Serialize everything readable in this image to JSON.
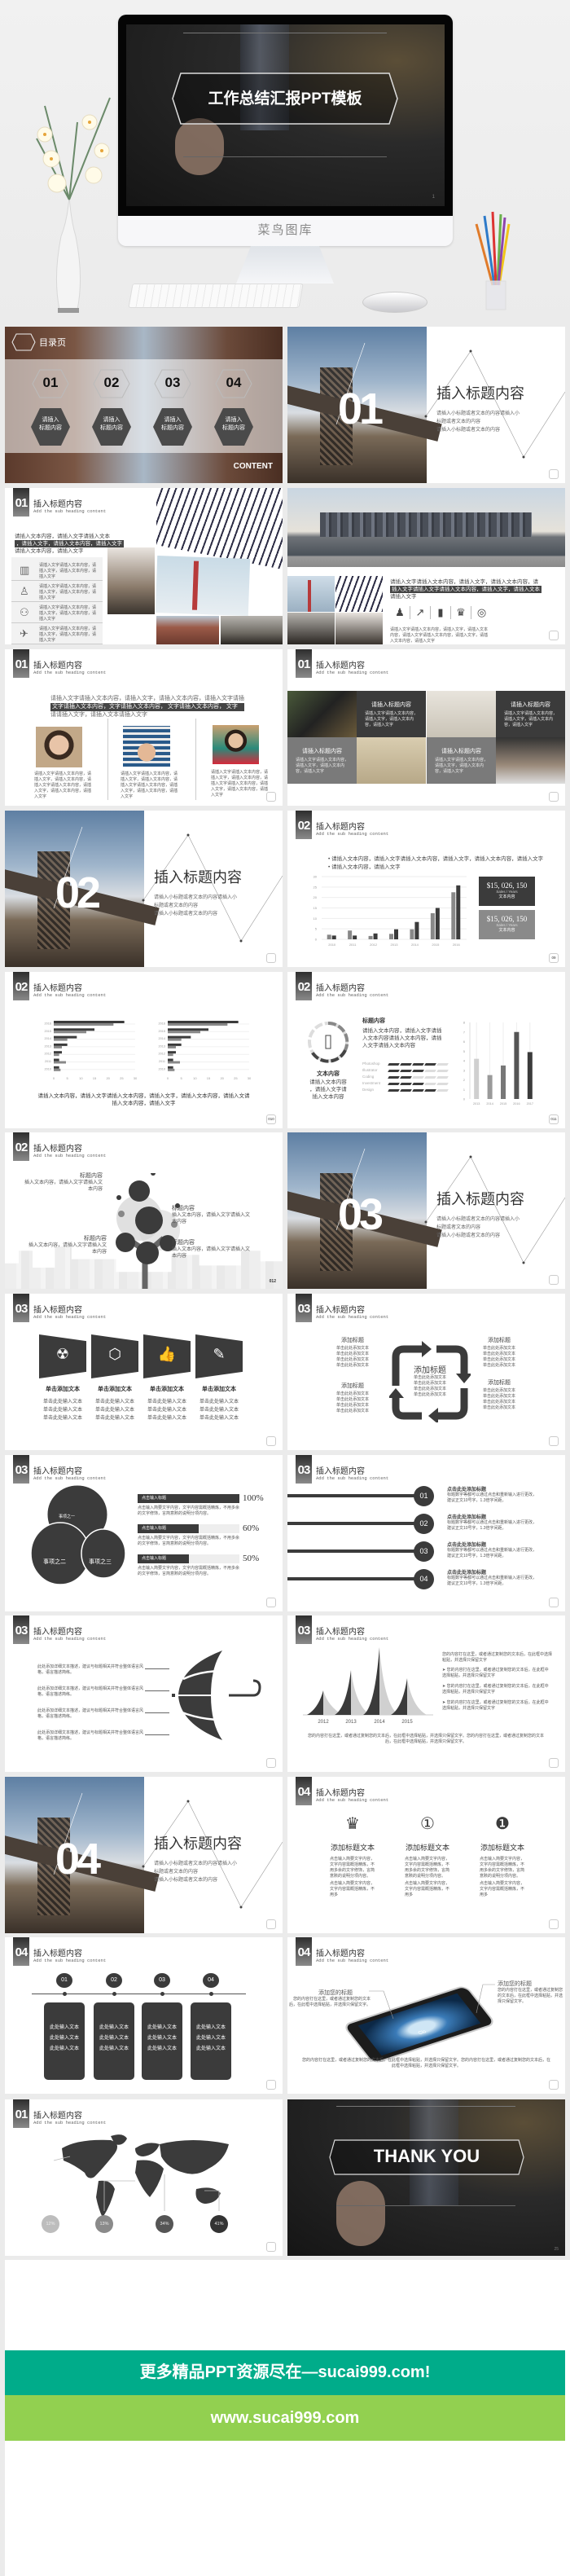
{
  "colors": {
    "dark": "#3b3b3b",
    "gray": "#8a8a8a",
    "banner_teal": "#00ac8a",
    "banner_green": "#92d050",
    "page_bg": "#ebebeb"
  },
  "hero": {
    "slide_title": "工作总结汇报PPT模板",
    "brand": "菜鸟图库",
    "slide_number": "1"
  },
  "common": {
    "heading": "插入标题内容",
    "subheading": "Add the sub heading content"
  },
  "section": {
    "title": "插入标题内容",
    "desc": [
      "请插入小标题或者文本的内容请插入小",
      "标题或者文本的内容",
      "请插入小标题或者文本的内容"
    ],
    "numbers": [
      "01",
      "02",
      "03",
      "04"
    ]
  },
  "toc": {
    "title": "目录页",
    "items": [
      {
        "num": "01",
        "label": "请插入\n标题内容"
      },
      {
        "num": "02",
        "label": "请插入\n标题内容"
      },
      {
        "num": "03",
        "label": "请插入\n标题内容"
      },
      {
        "num": "04",
        "label": "请插入\n标题内容"
      }
    ],
    "content_label": "CONTENT"
  },
  "collage": {
    "num": "01",
    "lines": [
      "请插入文本内容，请插入文字请插入文本",
      "，请插入文字，请插入文本内容，请插入文字",
      "请插入文本内容，请插入文字"
    ],
    "list": [
      {
        "icon": "building-icon",
        "text": "请插入文字请插入文本内容，请插入文字，请插入文本内容，请插入文字"
      },
      {
        "icon": "office-chair-icon",
        "text": "请插入文字请插入文本内容，请插入文字，请插入文本内容，请插入文字"
      },
      {
        "icon": "meeting-icon",
        "text": "请插入文字请插入文本内容，请插入文字，请插入文本内容，请插入文字"
      },
      {
        "icon": "airplane-icon",
        "text": "请插入文字请插入文本内容，请插入文字，请插入文本内容，请插入文字"
      }
    ]
  },
  "skyline": {
    "lines": [
      "请插入文字请插入文本内容，请插入文字，请插入文本内容，请",
      "插入文字请插入文字请插入文本内容，请插入文字，请插入文本",
      "请插入文字"
    ],
    "icons": [
      "team-icon",
      "growth-chart-icon",
      "bar-chart-icon",
      "trophy-icon",
      "coins-icon"
    ],
    "small": "请插入文字请插入文本内容，请插入文字，请插入文本内容，请插入文字请插入文本内容，请插入文字，请插入文本内容，请插入文字"
  },
  "kids": {
    "num": "01",
    "lines": [
      "请插入文字请插入文本内容，请插入文字，请插入文本内容，请插入文字请插",
      "文字请插入文本内容，文字请插入文本内容，   文字请插入文本内容，   文字",
      "请请插入文字，请插入文本请插入文字"
    ],
    "captions": [
      "请插入文字请插入文本内容，请插入文字，请插入文本内容，请插入文字请插入文本内容，请插入文字，请插入文本内容，请插入文字",
      "请插入文字请插入文本内容，请插入文字，请插入文本内容，请插入文字请插入文本内容，请插入文字，请插入文本内容，请插入文字",
      "请插入文字请插入文本内容，请插入文字，请插入文本内容，请插入文字请插入文本内容，请插入文字，请插入文本内容，请插入文字"
    ]
  },
  "tiles": {
    "num": "01",
    "items": [
      {
        "title": "请插入标题内容",
        "text": "请插入文字请插入文本内容，请插入文字，请插入文本内容，请插入文字"
      },
      {
        "title": "请插入标题内容",
        "text": "请插入文字请插入文本内容，请插入文字，请插入文本内容，请插入文字"
      },
      {
        "title": "请插入标题内容",
        "text": "请插入文字请插入文本内容，请插入文字，请插入文本内容，请插入文字"
      },
      {
        "title": "请插入标题内容",
        "text": "请插入文字请插入文本内容，请插入文字，请插入文本内容，请插入文字"
      }
    ]
  },
  "barslide": {
    "num": "02",
    "bullets": [
      "请插入文本内容，请插入文字请插入文本内容，请插入文字，请插入文本内容，请插入文字",
      "请插入文本内容，请插入文字"
    ],
    "boxes": [
      {
        "value": "$15, 026, 150",
        "sub": "Sales / Years",
        "label": "文本内容"
      },
      {
        "value": "$15, 026, 150",
        "sub": "Sales / Years",
        "label": "文本内容"
      }
    ],
    "page": "09"
  },
  "hbarslide": {
    "num": "02",
    "caption": [
      "请插入文本内容，请插入文字请插入文本内容，请插入文字，请插入文本内容，请插入文请",
      "插入文本内容，请插入文字"
    ],
    "page": "010"
  },
  "donutslide": {
    "num": "02",
    "title": "标题内容",
    "text": [
      "请插入文本内容，请插入文字请插",
      "入文本内容请插入文本内容，请插",
      "入文字请插入文本内容"
    ],
    "left_title": "文本内容",
    "left_text": [
      "请插入文本内容",
      "，请插入文字请",
      "插入文本内容"
    ],
    "skills": [
      {
        "name": "Photoshop",
        "level": 4,
        "max": 5
      },
      {
        "name": "Illustrator",
        "level": 3,
        "max": 5
      },
      {
        "name": "Coding",
        "level": 2,
        "max": 5
      },
      {
        "name": "Investment",
        "level": 3,
        "max": 5
      },
      {
        "name": "Design",
        "level": 4,
        "max": 5
      }
    ],
    "page": "011"
  },
  "tree": {
    "num": "02",
    "items": [
      {
        "title": "标题内容",
        "text": "插入文本内容，请插入文字请插入文本内容"
      },
      {
        "title": "标题内容",
        "text": "插入文本内容，请插入文字请插入文本内容"
      },
      {
        "title": "标题内容",
        "text": "插入文本内容，请插入文字请插入文本内容"
      },
      {
        "title": "标题内容",
        "text": "插入文本内容，请插入文字请插入文本内容"
      }
    ],
    "page": "012"
  },
  "trap": {
    "num": "03",
    "items": [
      {
        "icon": "radiation-icon",
        "title": "单击添加文本"
      },
      {
        "icon": "cube-icon",
        "title": "单击添加文本"
      },
      {
        "icon": "thumbs-up-icon",
        "title": "单击添加文本"
      },
      {
        "icon": "pencil-icon",
        "title": "单击添加文本"
      }
    ],
    "line": "单击此处输入文本"
  },
  "cycle": {
    "num": "03",
    "center": "添加标题",
    "title": "添加标题",
    "line": "单击此处添加文本"
  },
  "venn": {
    "num": "03",
    "circles": [
      "事项之一",
      "事项之二",
      "事项之三"
    ],
    "bars": [
      {
        "label": "点击输入标题",
        "percent": 100
      },
      {
        "label": "点击输入标题",
        "percent": 60
      },
      {
        "label": "点击输入标题",
        "percent": 50
      }
    ],
    "desc": "点击输入简要文字内容，文字内容需概括精炼，不用多余的文字修饰，言简意赅的说明分项内容。"
  },
  "lines": {
    "num": "03",
    "items": [
      {
        "n": "01",
        "title": "点击此处添加标题"
      },
      {
        "n": "02",
        "title": "点击此处添加标题"
      },
      {
        "n": "03",
        "title": "点击此处添加标题"
      },
      {
        "n": "04",
        "title": "点击此处添加标题"
      }
    ],
    "desc": "标题数字等都可以通过点击和重新输入进行更改，建议正文10号字，1.3倍字间距。"
  },
  "umbrella": {
    "num": "03",
    "text": "此处添加详细文本描述，建议与标题相关并符合整体语言风格，语言描述简练。"
  },
  "mountain": {
    "num": "03",
    "intro": "您的内容打在这里，或者通过复制您的文本后，在此框中选择粘贴，并选择只保留文字",
    "bullets": [
      "您的内容打在这里，或者通过复制您的文本后，在此框中选择粘贴，并选择只保留文字",
      "您的内容打在这里，或者通过复制您的文本后，在此框中选择粘贴，并选择只保留文字",
      "您的内容打在这里，或者通过复制您的文本后，在此框中选择粘贴，并选择只保留文字"
    ],
    "bottom": "您的内容打在这里，或者通过复制您的文本后，在此框中选择粘贴，并选择只保留文字。您的内容打在这里，或者通过复制您的文本后，在此框中选择粘贴，并选择只保留文字。"
  },
  "awards": {
    "num": "04",
    "items": [
      {
        "icon": "trophy-icon",
        "title": "添加标题文本"
      },
      {
        "icon": "medal-icon",
        "title": "添加标题文本"
      },
      {
        "icon": "badge-icon",
        "title": "添加标题文本"
      }
    ],
    "text": "点击输入简要文字内容，文字内容需概括精炼，不用多余的文字修饰，言简意赅的说明分项内容。"
  },
  "timeline": {
    "num": "04",
    "items": [
      "01",
      "02",
      "03",
      "04"
    ],
    "line": "此处输入文本"
  },
  "phone": {
    "num": "04",
    "labels": [
      "添加您的标题",
      "添加您的标题"
    ],
    "text": "您的内容打在这里，或者通过复制您的文本后，在此框中选择粘贴，并选择只保留文字。",
    "screen_text": "Clo",
    "bottom": "您的内容打在这里，或者通过复制您的文本后，在此框中选择粘贴，并选择只保留文字。您的内容打在这里，或者通过复制您的文本后，在此框中选择粘贴，并选择只保留文字。"
  },
  "map": {
    "num": "01",
    "markers": [
      {
        "value": "12%",
        "color": "#bdbdbd"
      },
      {
        "value": "13%",
        "color": "#8a8a8a"
      },
      {
        "value": "34%",
        "color": "#555555"
      },
      {
        "value": "41%",
        "color": "#333333"
      }
    ]
  },
  "thanks": {
    "title": "THANK YOU",
    "page": "25"
  },
  "banner": {
    "line1": "更多精品PPT资源尽在—sucai999.com!",
    "line2": "www.sucai999.com"
  },
  "chart_data": [
    {
      "type": "bar",
      "categories": [
        "2010",
        "2011",
        "2012",
        "2013",
        "2014",
        "2015",
        "2016"
      ],
      "series": [
        {
          "values": [
            2.2,
            4.2,
            1.6,
            2.6,
            4.8,
            12.5,
            22.5
          ]
        },
        {
          "values": [
            1.8,
            1.8,
            2.8,
            4.8,
            8.3,
            15,
            25.8
          ]
        }
      ],
      "ylim": [
        0,
        30
      ],
      "yticks": [
        "0",
        "5",
        "10",
        "15",
        "20",
        "25",
        "30"
      ],
      "grid": true
    },
    {
      "type": "bar",
      "orientation": "horizontal",
      "categories": [
        "2016",
        "2015",
        "2014",
        "2013",
        "2012",
        "2011",
        "2010"
      ],
      "series": [
        {
          "values": [
            26,
            15,
            8.5,
            5,
            3,
            2,
            2
          ]
        },
        {
          "values": [
            22,
            12,
            5,
            3,
            2,
            4.5,
            2.5
          ]
        }
      ],
      "xlim": [
        0,
        30
      ],
      "xticks": [
        "0",
        "5",
        "10",
        "15",
        "20",
        "25",
        "30"
      ]
    },
    {
      "type": "bar",
      "orientation": "horizontal",
      "categories": [
        "2016",
        "2015",
        "2014",
        "2013",
        "2012",
        "2011",
        "2010"
      ],
      "series": [
        {
          "values": [
            26,
            15,
            8.5,
            5,
            3,
            2,
            2
          ]
        },
        {
          "values": [
            22,
            12,
            5,
            3,
            2,
            4.5,
            2.5
          ]
        }
      ],
      "xlim": [
        0,
        30
      ],
      "xticks": [
        "0",
        "5",
        "10",
        "15",
        "20",
        "25",
        "30"
      ]
    },
    {
      "type": "bar",
      "categories": [
        "2013",
        "2014",
        "2015",
        "2016",
        "2017"
      ],
      "values": [
        4.2,
        2.5,
        3.5,
        7,
        4.9
      ],
      "ylim": [
        0,
        8
      ],
      "yticks": [
        "0",
        "1",
        "2",
        "3",
        "4",
        "5",
        "6",
        "7",
        "8"
      ]
    },
    {
      "type": "area",
      "categories": [
        "2012",
        "2013",
        "2014",
        "2015"
      ],
      "values": [
        3,
        5.5,
        8.3,
        4.5
      ]
    }
  ]
}
